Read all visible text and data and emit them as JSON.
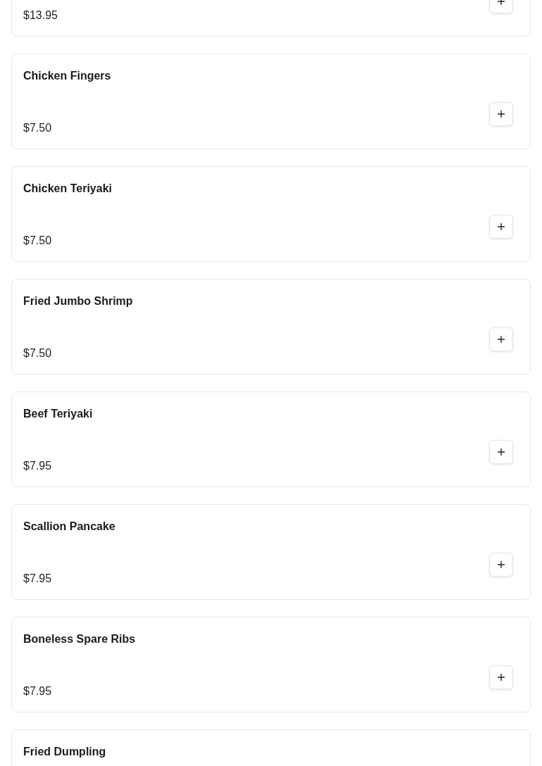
{
  "items": [
    {
      "price": "$13.95"
    },
    {
      "name": "Chicken Fingers",
      "price": "$7.50"
    },
    {
      "name": "Chicken Teriyaki",
      "price": "$7.50"
    },
    {
      "name": "Fried Jumbo Shrimp",
      "price": "$7.50"
    },
    {
      "name": "Beef Teriyaki",
      "price": "$7.95"
    },
    {
      "name": "Scallion Pancake",
      "price": "$7.95"
    },
    {
      "name": "Boneless Spare Ribs",
      "price": "$7.95"
    },
    {
      "name": "Fried Dumpling"
    }
  ]
}
